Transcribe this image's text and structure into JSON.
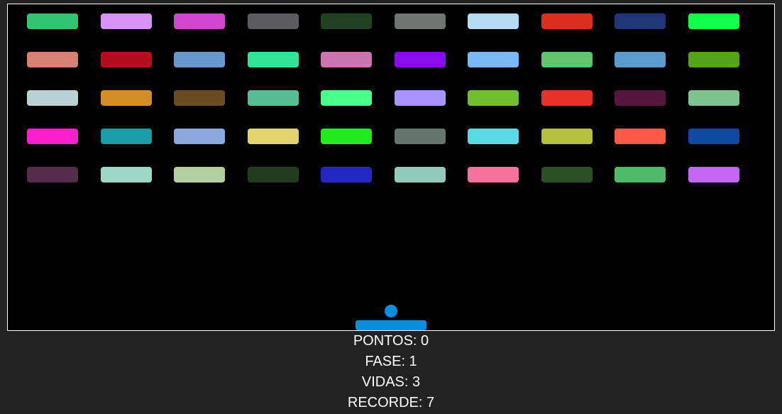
{
  "game": {
    "bricks": {
      "rows": 5,
      "cols": 10,
      "colors": [
        [
          "#33c473",
          "#d692f7",
          "#d146d1",
          "#5c5a63",
          "#224022",
          "#6d7671",
          "#b4dbf3",
          "#dc2f22",
          "#21347a",
          "#12ff4a"
        ],
        [
          "#d97f74",
          "#b40d20",
          "#6797cc",
          "#30e597",
          "#cc73b0",
          "#8d09ee",
          "#7ab9f8",
          "#61c46e",
          "#5a9ccd",
          "#55a31d"
        ],
        [
          "#b9d2d6",
          "#d38f25",
          "#6a4b22",
          "#58bd93",
          "#4cfd8a",
          "#aa93fb",
          "#71bf30",
          "#ea3129",
          "#571540",
          "#7bc48f"
        ],
        [
          "#fb20cb",
          "#1a9ea5",
          "#8ba9dd",
          "#e2d46c",
          "#20ec1e",
          "#66766f",
          "#5adae2",
          "#b5c03e",
          "#fc5843",
          "#1349a6"
        ],
        [
          "#552c4a",
          "#9dd7c8",
          "#b2cfa1",
          "#203c1d",
          "#2326c1",
          "#92cbbb",
          "#f4729c",
          "#2d4f26",
          "#50ba6b",
          "#c367f4"
        ]
      ]
    },
    "ball_color": "#0a8fe0",
    "paddle_color": "#0a8fe0"
  },
  "hud": {
    "score": "PONTOS: 0",
    "level": "FASE: 1",
    "lives": "VIDAS: 3",
    "record": "RECORDE: 7"
  }
}
